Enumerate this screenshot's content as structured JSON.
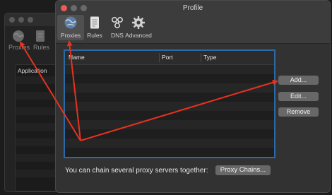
{
  "background_window": {
    "toolbar": [
      {
        "label": "Proxies",
        "icon": "globe-icon"
      },
      {
        "label": "Rules",
        "icon": "document-icon"
      }
    ],
    "table_header": "Application"
  },
  "window": {
    "title": "Profile",
    "toolbar": [
      {
        "label": "Proxies",
        "icon": "globe-icon"
      },
      {
        "label": "Rules",
        "icon": "document-icon"
      },
      {
        "label": "DNS",
        "icon": "dns-icon"
      },
      {
        "label": "Advanced",
        "icon": "gear-icon"
      }
    ]
  },
  "proxy_table": {
    "columns": [
      "Name",
      "Port",
      "Type"
    ],
    "rows": []
  },
  "buttons": {
    "add": "Add...",
    "edit": "Edit...",
    "remove": "Remove",
    "proxy_chains": "Proxy Chains..."
  },
  "footer_text": "You can chain several proxy servers together:",
  "colors": {
    "annotation_arrow": "#e8321e",
    "table_highlight": "#2b6aa8"
  }
}
